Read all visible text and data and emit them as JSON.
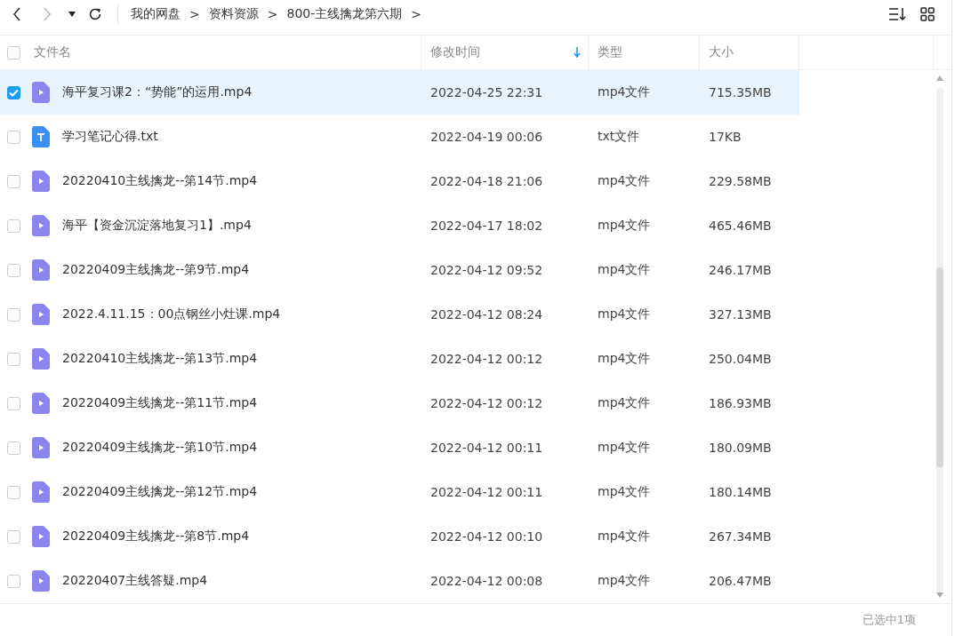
{
  "breadcrumb": [
    {
      "label": "我的网盘",
      "separator": ">"
    },
    {
      "label": "资料资源",
      "separator": ">"
    },
    {
      "label": "800-主线擒龙第六期",
      "separator": ">"
    }
  ],
  "table": {
    "all_selected": false,
    "columns": [
      {
        "label": "文件名",
        "sorted": false
      },
      {
        "label": "修改时间",
        "sorted": true
      },
      {
        "label": "类型",
        "sorted": false
      },
      {
        "label": "大小",
        "sorted": false
      }
    ],
    "rows": [
      {
        "name": "海平复习课2：“势能”的运用.mp4",
        "modified": "2022-04-25 22:31",
        "type": "mp4文件",
        "size": "715.35MB",
        "kind": "video",
        "selected": true
      },
      {
        "name": "学习笔记心得.txt",
        "modified": "2022-04-19 00:06",
        "type": "txt文件",
        "size": "17KB",
        "kind": "text",
        "selected": false
      },
      {
        "name": "20220410主线擒龙--第14节.mp4",
        "modified": "2022-04-18 21:06",
        "type": "mp4文件",
        "size": "229.58MB",
        "kind": "video",
        "selected": false
      },
      {
        "name": "海平【资金沉淀落地复习1】.mp4",
        "modified": "2022-04-17 18:02",
        "type": "mp4文件",
        "size": "465.46MB",
        "kind": "video",
        "selected": false
      },
      {
        "name": "20220409主线擒龙--第9节.mp4",
        "modified": "2022-04-12 09:52",
        "type": "mp4文件",
        "size": "246.17MB",
        "kind": "video",
        "selected": false
      },
      {
        "name": "2022.4.11.15：00点钢丝小灶课.mp4",
        "modified": "2022-04-12 08:24",
        "type": "mp4文件",
        "size": "327.13MB",
        "kind": "video",
        "selected": false
      },
      {
        "name": "20220410主线擒龙--第13节.mp4",
        "modified": "2022-04-12 00:12",
        "type": "mp4文件",
        "size": "250.04MB",
        "kind": "video",
        "selected": false
      },
      {
        "name": "20220409主线擒龙--第11节.mp4",
        "modified": "2022-04-12 00:12",
        "type": "mp4文件",
        "size": "186.93MB",
        "kind": "video",
        "selected": false
      },
      {
        "name": "20220409主线擒龙--第10节.mp4",
        "modified": "2022-04-12 00:11",
        "type": "mp4文件",
        "size": "180.09MB",
        "kind": "video",
        "selected": false
      },
      {
        "name": "20220409主线擒龙--第12节.mp4",
        "modified": "2022-04-12 00:11",
        "type": "mp4文件",
        "size": "180.14MB",
        "kind": "video",
        "selected": false
      },
      {
        "name": "20220409主线擒龙--第8节.mp4",
        "modified": "2022-04-12 00:10",
        "type": "mp4文件",
        "size": "267.34MB",
        "kind": "video",
        "selected": false
      },
      {
        "name": "20220407主线答疑.mp4",
        "modified": "2022-04-12 00:08",
        "type": "mp4文件",
        "size": "206.47MB",
        "kind": "video",
        "selected": false
      }
    ]
  },
  "status_bar": "已选中1项"
}
